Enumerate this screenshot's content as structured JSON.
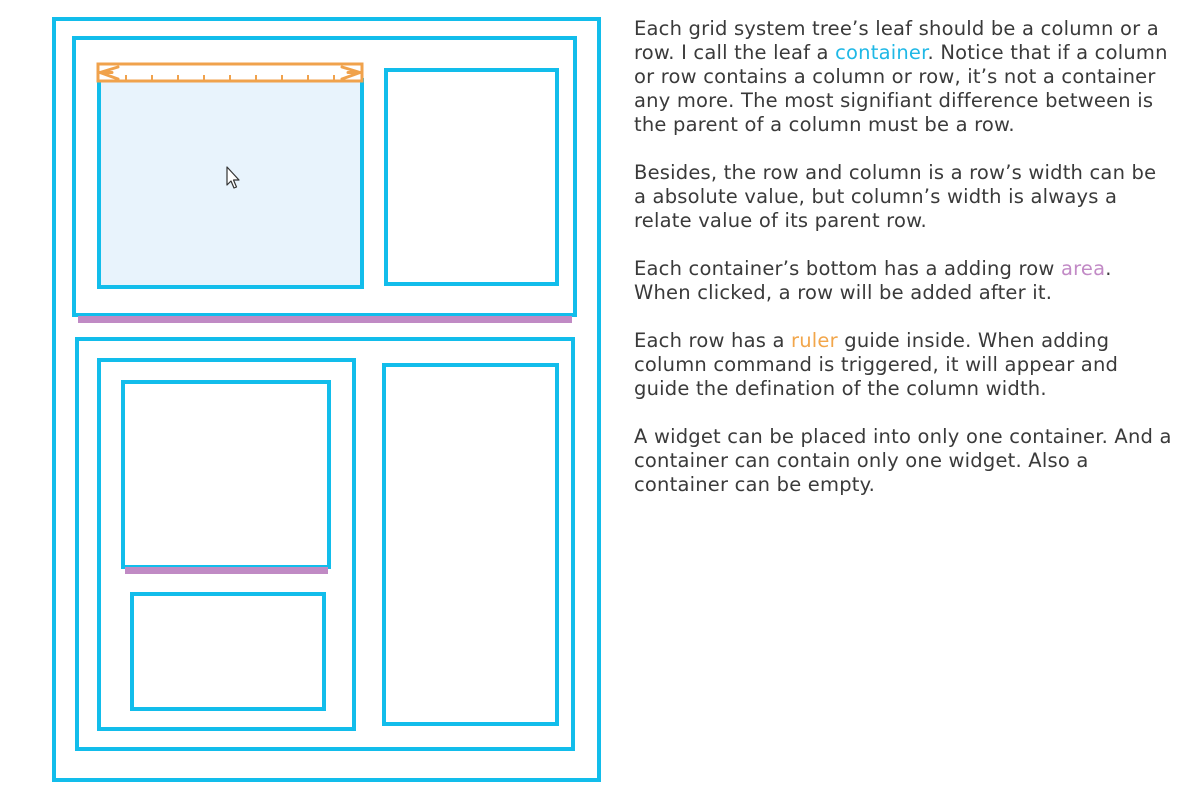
{
  "colors": {
    "container_stroke": "#12bdeb",
    "area_bar": "#c08ac4",
    "ruler": "#f0a24c",
    "selected_fill": "#e8f3fc",
    "text": "#3a3a3a"
  },
  "diagram": {
    "cursor_icon": "arrow-pointer-icon"
  },
  "notes": {
    "p1_a": "Each grid system tree’s leaf should be a column or a row. I call the leaf a ",
    "p1_container": "container",
    "p1_b": ". Notice that if a column or row contains a column or row, it’s not a container any more. The most signifiant difference between is the parent of a column must be a row.",
    "p2": "Besides, the row and column is a row’s width can be a absolute value, but column’s width is always a relate value of its parent row.",
    "p3_a": "Each container’s bottom has a adding row ",
    "p3_area": "area",
    "p3_b": ". When clicked, a row will be added after it.",
    "p4_a": "Each row has a ",
    "p4_ruler": "ruler",
    "p4_b": " guide inside. When adding column command is triggered, it will appear and guide the defination of the column width.",
    "p5": "A widget can be placed into only one container. And a container can contain only one widget. Also a container can be empty."
  }
}
